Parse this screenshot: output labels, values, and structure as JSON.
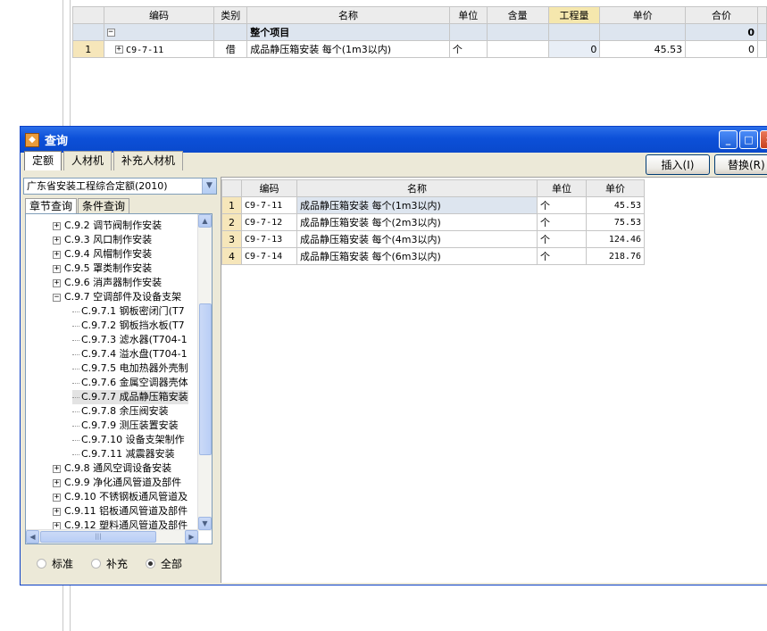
{
  "top_grid": {
    "headers": [
      "编码",
      "类别",
      "名称",
      "单位",
      "含量",
      "工程量",
      "单价",
      "合价"
    ],
    "group_row": {
      "toggle": "−",
      "name": "整个项目",
      "total": "0"
    },
    "rows": [
      {
        "num": "1",
        "toggle": "+",
        "code": "C9-7-11",
        "type": "借",
        "name": "成品静压箱安装 每个(1m3以内)",
        "unit": "个",
        "qty": "0",
        "price": "45.53",
        "total": "0"
      }
    ]
  },
  "dialog": {
    "title": "查询",
    "window_buttons": {
      "minimize": "_",
      "maximize": "□",
      "close": "×"
    },
    "tabs": [
      "定额",
      "人材机",
      "补充人材机"
    ],
    "insert_button": "插入(I)",
    "replace_button": "替换(R)",
    "quota_select": "广东省安装工程综合定额(2010)",
    "sub_tabs": [
      "章节查询",
      "条件查询"
    ],
    "tree": [
      {
        "toggle": "+",
        "label": "C.9.2 调节阀制作安装"
      },
      {
        "toggle": "+",
        "label": "C.9.3 风口制作安装"
      },
      {
        "toggle": "+",
        "label": "C.9.4 风帽制作安装"
      },
      {
        "toggle": "+",
        "label": "C.9.5 罩类制作安装"
      },
      {
        "toggle": "+",
        "label": "C.9.6 消声器制作安装"
      },
      {
        "toggle": "−",
        "label": "C.9.7 空调部件及设备支架"
      },
      {
        "label": "C.9.7.1 钢板密闭门(T7"
      },
      {
        "label": "C.9.7.2 钢板挡水板(T7"
      },
      {
        "label": "C.9.7.3 滤水器(T704-1"
      },
      {
        "label": "C.9.7.4 溢水盘(T704-1"
      },
      {
        "label": "C.9.7.5 电加热器外壳制"
      },
      {
        "label": "C.9.7.6 金属空调器壳体"
      },
      {
        "label": "C.9.7.7 成品静压箱安装",
        "selected": true
      },
      {
        "label": "C.9.7.8 余压阀安装"
      },
      {
        "label": "C.9.7.9 测压装置安装"
      },
      {
        "label": "C.9.7.10 设备支架制作"
      },
      {
        "label": "C.9.7.11 减震器安装"
      },
      {
        "toggle": "+",
        "label": "C.9.8 通风空调设备安装"
      },
      {
        "toggle": "+",
        "label": "C.9.9 净化通风管道及部件"
      },
      {
        "toggle": "+",
        "label": "C.9.10 不锈钢板通风管道及"
      },
      {
        "toggle": "+",
        "label": "C.9.11 铝板通风管道及部件"
      },
      {
        "toggle": "+",
        "label": "C.9.12 塑料通风管道及部件"
      }
    ],
    "radios": [
      {
        "label": "标准",
        "checked": false
      },
      {
        "label": "补充",
        "checked": false
      },
      {
        "label": "全部",
        "checked": true
      }
    ],
    "query_table": {
      "headers": [
        "编码",
        "名称",
        "单位",
        "单价"
      ],
      "rows": [
        {
          "num": "1",
          "code": "C9-7-11",
          "name": "成品静压箱安装 每个(1m3以内)",
          "unit": "个",
          "price": "45.53"
        },
        {
          "num": "2",
          "code": "C9-7-12",
          "name": "成品静压箱安装 每个(2m3以内)",
          "unit": "个",
          "price": "75.53"
        },
        {
          "num": "3",
          "code": "C9-7-13",
          "name": "成品静压箱安装 每个(4m3以内)",
          "unit": "个",
          "price": "124.46"
        },
        {
          "num": "4",
          "code": "C9-7-14",
          "name": "成品静压箱安装 每个(6m3以内)",
          "unit": "个",
          "price": "218.76"
        }
      ]
    }
  }
}
